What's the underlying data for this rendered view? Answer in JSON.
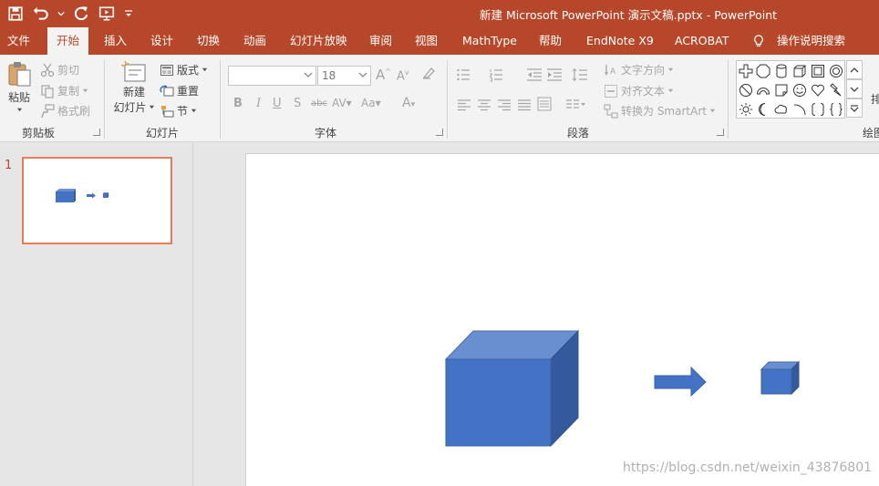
{
  "window": {
    "title": "新建 Microsoft PowerPoint 演示文稿.pptx  -  PowerPoint"
  },
  "tabs": [
    {
      "label": "文件"
    },
    {
      "label": "开始"
    },
    {
      "label": "插入"
    },
    {
      "label": "设计"
    },
    {
      "label": "切换"
    },
    {
      "label": "动画"
    },
    {
      "label": "幻灯片放映"
    },
    {
      "label": "审阅"
    },
    {
      "label": "视图"
    },
    {
      "label": "MathType"
    },
    {
      "label": "帮助"
    },
    {
      "label": "EndNote X9"
    },
    {
      "label": "ACROBAT"
    },
    {
      "label": "操作说明搜索"
    }
  ],
  "ribbon": {
    "clipboard": {
      "paste": "粘贴",
      "cut": "剪切",
      "copy": "复制",
      "format_painter": "格式刷",
      "label": "剪贴板"
    },
    "slides": {
      "new_slide_line1": "新建",
      "new_slide_line2": "幻灯片",
      "layout": "版式",
      "reset": "重置",
      "section": "节",
      "label": "幻灯片"
    },
    "font": {
      "font_name": "",
      "font_size": "18",
      "label": "字体"
    },
    "paragraph": {
      "text_direction": "文字方向",
      "align_text": "对齐文本",
      "smartart": "转换为 SmartArt",
      "label": "段落"
    },
    "drawing": {
      "label": "绘图",
      "arrange_partial": "排"
    }
  },
  "slides_pane": {
    "slide_number": "1"
  },
  "colors": {
    "accent": "#b7472a",
    "cube_front": "#4472c4",
    "cube_top": "#6a8fd0",
    "cube_side": "#35599d"
  },
  "watermark": "https://blog.csdn.net/weixin_43876801"
}
